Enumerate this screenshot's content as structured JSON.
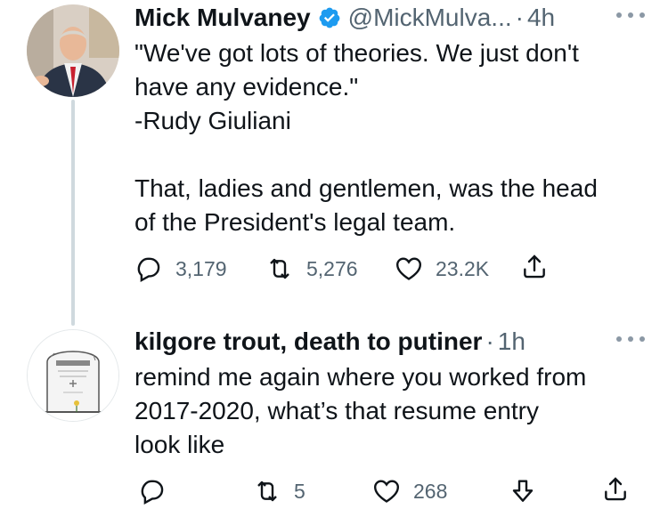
{
  "tweet1": {
    "name": "Mick Mulvaney",
    "handle": "@MickMulva...",
    "time": "4h",
    "body": "\"We've got lots of theories.  We just don't\nhave any evidence.\"\n-Rudy Giuliani\n\nThat, ladies and gentlemen, was the head\nof the President's legal team.",
    "replies": "3,179",
    "retweets": "5,276",
    "likes": "23.2K",
    "icons": [
      "verified-badge-icon",
      "more-icon",
      "reply-icon",
      "retweet-icon",
      "like-icon",
      "share-icon"
    ]
  },
  "tweet2": {
    "name": "kilgore trout, death to putiner",
    "time": "1h",
    "body": "remind me again where you worked from\n2017-2020, what’s that resume entry\nlook like",
    "retweets": "5",
    "likes": "268",
    "icons": [
      "more-icon",
      "reply-icon",
      "retweet-icon",
      "like-icon",
      "downvote-icon",
      "share-icon"
    ]
  },
  "separator": "·",
  "colors": {
    "text": "#0f1419",
    "secondary": "#536471",
    "verified": "#1d9bf0",
    "thread_line": "#cfd9de"
  }
}
